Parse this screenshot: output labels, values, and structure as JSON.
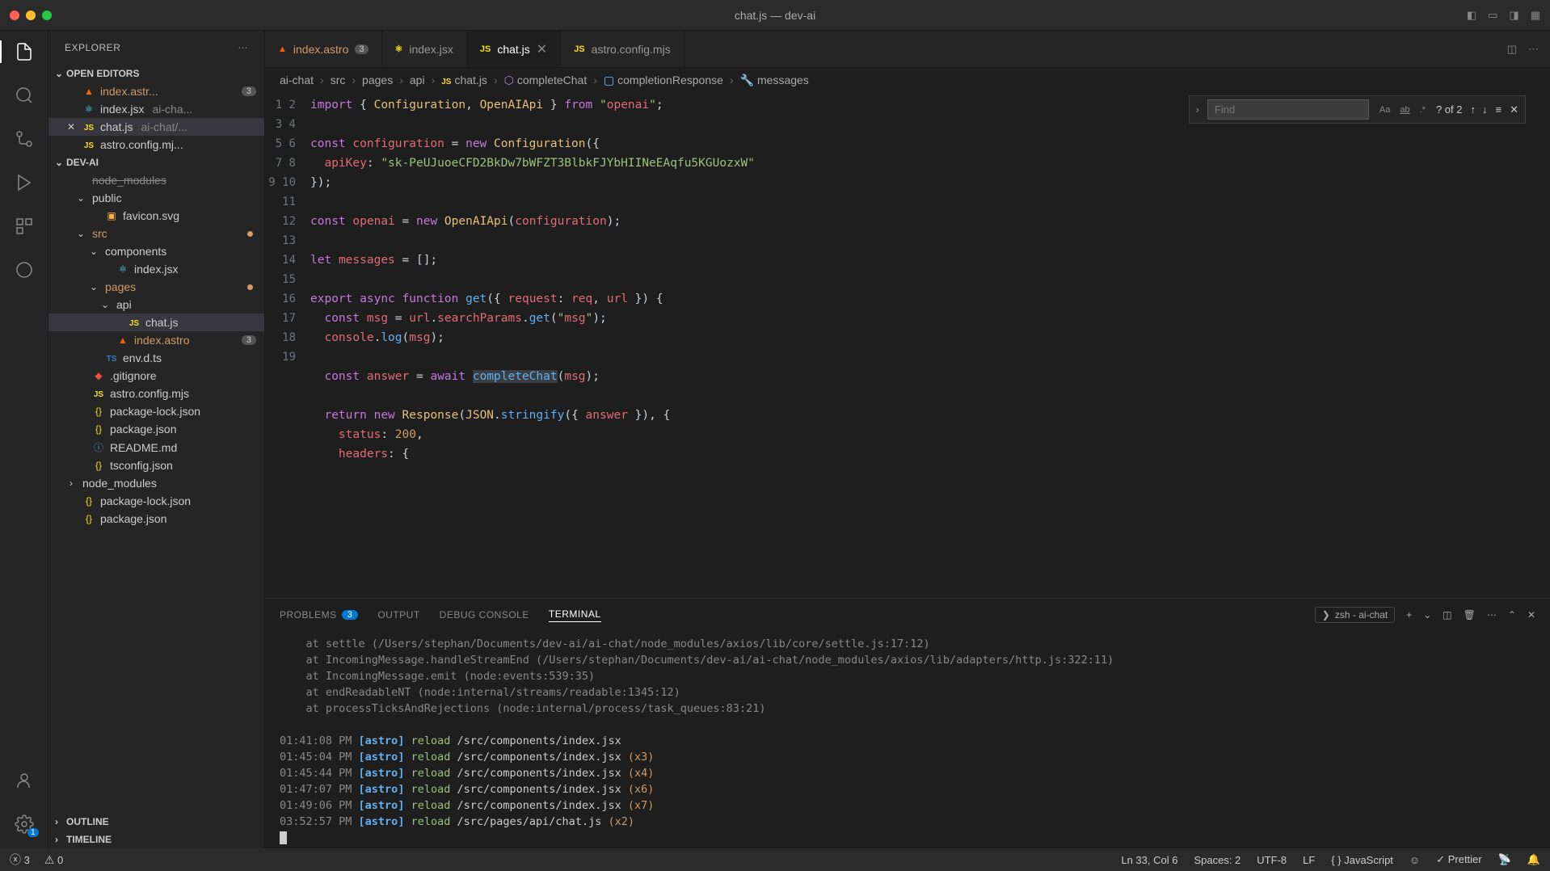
{
  "window": {
    "title": "chat.js — dev-ai"
  },
  "sidebar": {
    "title": "EXPLORER",
    "sections": {
      "openEditors": "OPEN EDITORS",
      "project": "DEV-AI",
      "outline": "OUTLINE",
      "timeline": "TIMELINE"
    },
    "openEditors": [
      {
        "name": "index.astr...",
        "badge": "3",
        "icon": "astro",
        "orange": true
      },
      {
        "name": "index.jsx",
        "hint": "ai-cha...",
        "icon": "react"
      },
      {
        "name": "chat.js",
        "hint": "ai-chat/...",
        "icon": "js",
        "active": true,
        "close": true
      },
      {
        "name": "astro.config.mj...",
        "icon": "js"
      }
    ],
    "tree": [
      {
        "label": "node_modules",
        "indent": 1,
        "muted": true,
        "strike": true
      },
      {
        "label": "public",
        "indent": 1,
        "chev": "v"
      },
      {
        "label": "favicon.svg",
        "indent": 2,
        "icon": "svg"
      },
      {
        "label": "src",
        "indent": 1,
        "chev": "v",
        "orange": true,
        "dot": true
      },
      {
        "label": "components",
        "indent": 2,
        "chev": "v"
      },
      {
        "label": "index.jsx",
        "indent": 3,
        "icon": "react"
      },
      {
        "label": "pages",
        "indent": 2,
        "chev": "v",
        "orange": true,
        "dot": true
      },
      {
        "label": "api",
        "indent": 3,
        "chev": "v"
      },
      {
        "label": "chat.js",
        "indent": 4,
        "icon": "js",
        "active": true
      },
      {
        "label": "index.astro",
        "indent": 3,
        "icon": "astro",
        "orange": true,
        "badge": "3"
      },
      {
        "label": "env.d.ts",
        "indent": 2,
        "icon": "ts"
      },
      {
        "label": ".gitignore",
        "indent": 1,
        "icon": "git"
      },
      {
        "label": "astro.config.mjs",
        "indent": 1,
        "icon": "js"
      },
      {
        "label": "package-lock.json",
        "indent": 1,
        "icon": "json"
      },
      {
        "label": "package.json",
        "indent": 1,
        "icon": "json"
      },
      {
        "label": "README.md",
        "indent": 1,
        "icon": "md"
      },
      {
        "label": "tsconfig.json",
        "indent": 1,
        "icon": "json"
      },
      {
        "label": "node_modules",
        "indent": 0,
        "chev": ">"
      },
      {
        "label": "package-lock.json",
        "indent": 0,
        "icon": "json"
      },
      {
        "label": "package.json",
        "indent": 0,
        "icon": "json"
      }
    ]
  },
  "tabs": [
    {
      "label": "index.astro",
      "badge": "3",
      "orange": true,
      "icon": "▲"
    },
    {
      "label": "index.jsx",
      "icon": "⚛"
    },
    {
      "label": "chat.js",
      "active": true,
      "close": true,
      "icon": "JS"
    },
    {
      "label": "astro.config.mjs",
      "icon": "JS"
    }
  ],
  "breadcrumb": [
    "ai-chat",
    "src",
    "pages",
    "api",
    "chat.js",
    "completeChat",
    "completionResponse",
    "messages"
  ],
  "find": {
    "placeholder": "Find",
    "result": "? of 2"
  },
  "code": {
    "lines": 19,
    "content": [
      "import { Configuration, OpenAIApi } from \"openai\";",
      "",
      "const configuration = new Configuration({",
      "  apiKey: \"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\"",
      "});",
      "",
      "const openai = new OpenAIApi(configuration);",
      "",
      "let messages = [];",
      "",
      "export async function get({ request: req, url }) {",
      "  const msg = url.searchParams.get(\"msg\");",
      "  console.log(msg);",
      "",
      "  const answer = await completeChat(msg);",
      "",
      "  return new Response(JSON.stringify({ answer }), {",
      "    status: 200,",
      "    headers: {"
    ]
  },
  "panel": {
    "tabs": {
      "problems": "PROBLEMS",
      "problemsBadge": "3",
      "output": "OUTPUT",
      "debug": "DEBUG CONSOLE",
      "terminal": "TERMINAL"
    },
    "termLabel": "zsh - ai-chat",
    "stack": [
      "    at settle (/Users/stephan/Documents/dev-ai/ai-chat/node_modules/axios/lib/core/settle.js:17:12)",
      "    at IncomingMessage.handleStreamEnd (/Users/stephan/Documents/dev-ai/ai-chat/node_modules/axios/lib/adapters/http.js:322:11)",
      "    at IncomingMessage.emit (node:events:539:35)",
      "    at endReadableNT (node:internal/streams/readable:1345:12)",
      "    at processTicksAndRejections (node:internal/process/task_queues:83:21)"
    ],
    "logs": [
      {
        "time": "01:41:08 PM",
        "path": "/src/components/index.jsx",
        "mult": ""
      },
      {
        "time": "01:45:04 PM",
        "path": "/src/components/index.jsx",
        "mult": "(x3)"
      },
      {
        "time": "01:45:44 PM",
        "path": "/src/components/index.jsx",
        "mult": "(x4)"
      },
      {
        "time": "01:47:07 PM",
        "path": "/src/components/index.jsx",
        "mult": "(x6)"
      },
      {
        "time": "01:49:06 PM",
        "path": "/src/components/index.jsx",
        "mult": "(x7)"
      },
      {
        "time": "03:52:57 PM",
        "path": "/src/pages/api/chat.js",
        "mult": "(x2)"
      }
    ]
  },
  "status": {
    "errors": "3",
    "warnings": "0",
    "lncol": "Ln 33, Col 6",
    "spaces": "Spaces: 2",
    "encoding": "UTF-8",
    "eol": "LF",
    "lang": "JavaScript",
    "prettier": "Prettier"
  }
}
